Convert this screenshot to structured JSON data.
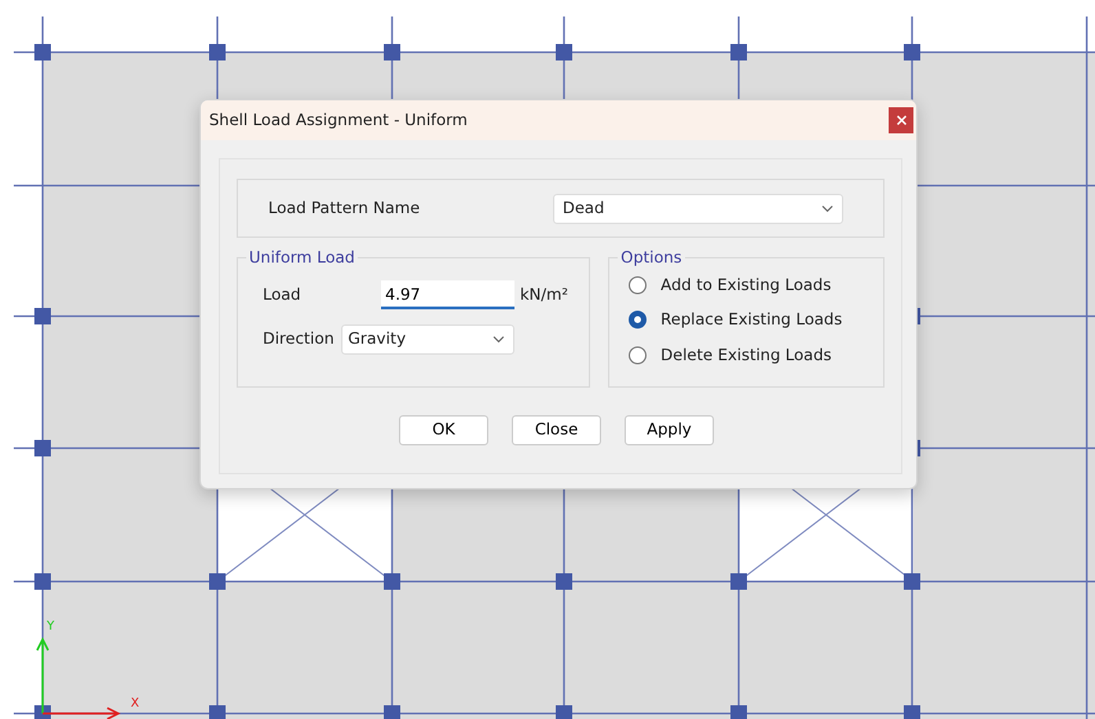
{
  "window": {
    "title": "Shell Load Assignment - Uniform"
  },
  "load_pattern": {
    "label": "Load Pattern Name",
    "value": "Dead"
  },
  "uniform_load": {
    "title": "Uniform Load",
    "load_label": "Load",
    "load_value": "4.97",
    "unit": "kN/m²",
    "direction_label": "Direction",
    "direction_value": "Gravity"
  },
  "options": {
    "title": "Options",
    "items": [
      {
        "label": "Add to Existing Loads",
        "selected": false
      },
      {
        "label": "Replace Existing Loads",
        "selected": true
      },
      {
        "label": "Delete Existing Loads",
        "selected": false
      }
    ]
  },
  "buttons": [
    "OK",
    "Close",
    "Apply"
  ],
  "axes": {
    "y_label": "Y",
    "x_label": "X"
  }
}
